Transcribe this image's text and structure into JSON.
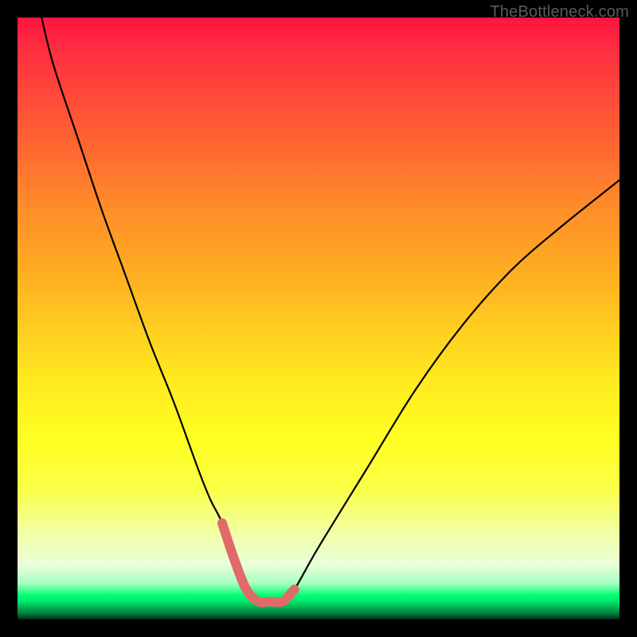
{
  "watermark": "TheBottleneck.com",
  "chart_data": {
    "type": "line",
    "title": "",
    "xlabel": "",
    "ylabel": "",
    "xlim": [
      0,
      100
    ],
    "ylim": [
      0,
      100
    ],
    "grid": false,
    "legend": false,
    "series": [
      {
        "name": "main-curve",
        "x": [
          4,
          6,
          10,
          14,
          18,
          22,
          26,
          30,
          32,
          34,
          36,
          38,
          40,
          42,
          44,
          46,
          50,
          58,
          66,
          74,
          82,
          90,
          100
        ],
        "values": [
          100,
          92,
          80,
          68,
          57,
          46,
          36,
          25,
          20,
          16,
          10,
          5,
          3,
          3,
          3,
          5,
          12,
          25,
          38,
          49,
          58,
          65,
          73
        ]
      },
      {
        "name": "highlight-segment",
        "x": [
          34,
          36,
          38,
          40,
          42,
          44,
          46
        ],
        "values": [
          16,
          10,
          5,
          3,
          3,
          3,
          5
        ]
      }
    ],
    "colors": {
      "main_curve": "#000000",
      "highlight": "#e06a6a",
      "gradient_top": "#ff143f",
      "gradient_mid_orange": "#ff8e29",
      "gradient_yellow": "#ffff22",
      "gradient_green": "#00ff74"
    },
    "annotations": []
  }
}
